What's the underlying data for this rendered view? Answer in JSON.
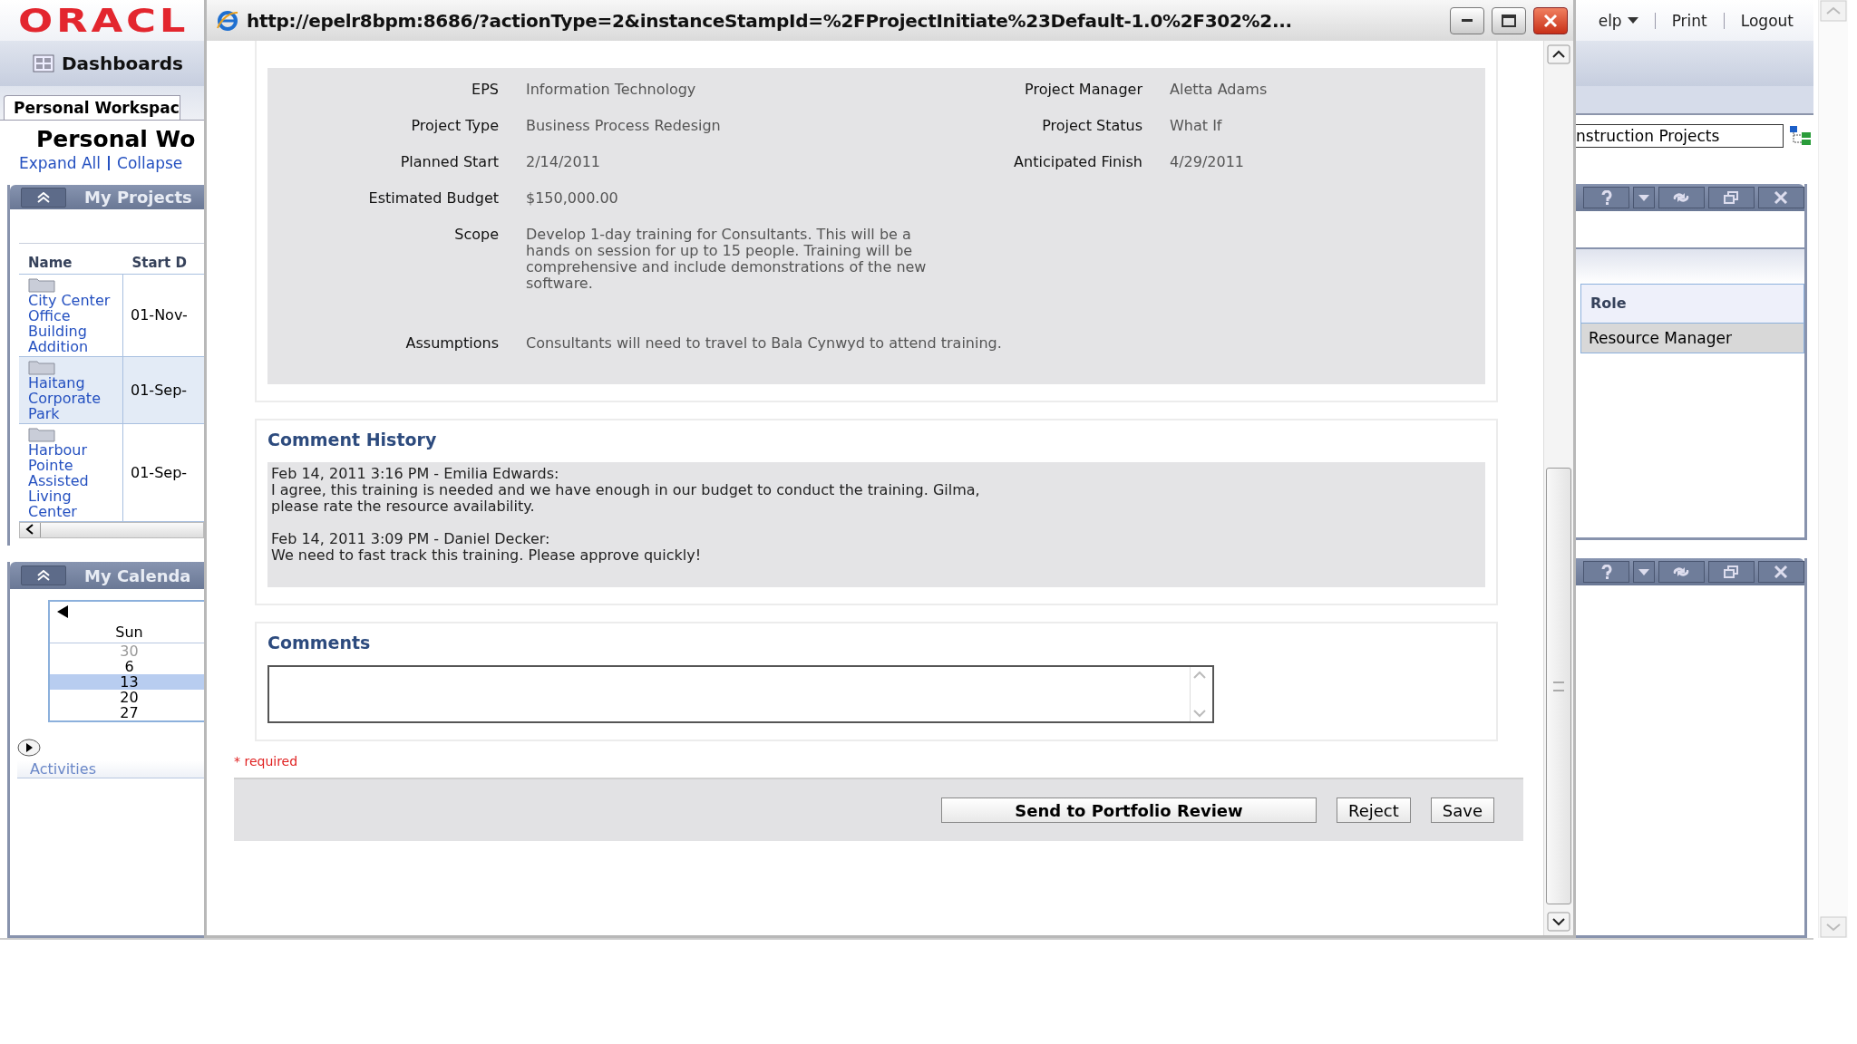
{
  "header": {
    "logo": "ORACL",
    "links": [
      {
        "label": "elp",
        "kind": "menu"
      },
      {
        "label": "Print",
        "kind": "link"
      },
      {
        "label": "Logout",
        "kind": "link"
      }
    ]
  },
  "nav": {
    "tab": "Dashboards"
  },
  "workspace": {
    "tab": "Personal Workspac",
    "title": "Personal Wo",
    "links": [
      "Expand All",
      "Collapse"
    ]
  },
  "my_projects": {
    "title": "My Projects",
    "columns": [
      "Name",
      "Start D"
    ],
    "rows": [
      {
        "name": "City Center Office Building Addition",
        "start": "01-Nov-",
        "selected": false
      },
      {
        "name": "Haitang Corporate Park",
        "start": "01-Sep-",
        "selected": true
      },
      {
        "name": "Harbour Pointe Assisted Living Center",
        "start": "01-Sep-",
        "selected": false
      }
    ]
  },
  "my_calendar": {
    "title": "My Calenda",
    "day_header": "Sun",
    "days": [
      {
        "label": "30",
        "muted": true,
        "selected": false
      },
      {
        "label": "6",
        "muted": false,
        "selected": false
      },
      {
        "label": "13",
        "muted": false,
        "selected": true
      },
      {
        "label": "20",
        "muted": false,
        "selected": false
      },
      {
        "label": "27",
        "muted": false,
        "selected": false
      }
    ]
  },
  "activities": {
    "label": "Activities"
  },
  "project_filter": {
    "value": "nstruction Projects"
  },
  "roles_portlet": {
    "columns": [
      "Role"
    ],
    "rows": [
      "Resource Manager"
    ]
  },
  "popup": {
    "title": "http://epelr8bpm:8686/?actionType=2&instanceStampId=%2FProjectInitiate%23Default-1.0%2F302%2...",
    "details": [
      [
        {
          "label": "EPS",
          "value": "Information Technology"
        },
        {
          "label": "Project Manager",
          "value": "Aletta Adams"
        }
      ],
      [
        {
          "label": "Project Type",
          "value": "Business Process Redesign"
        },
        {
          "label": "Project Status",
          "value": "What If"
        }
      ],
      [
        {
          "label": "Planned Start",
          "value": "2/14/2011"
        },
        {
          "label": "Anticipated Finish",
          "value": "4/29/2011"
        }
      ],
      [
        {
          "label": "Estimated Budget",
          "value": "$150,000.00"
        }
      ]
    ],
    "scope": {
      "label": "Scope",
      "lines": [
        "Develop 1-day training for Consultants.  This will be a",
        "hands on session for up to 15 people.  Training will be",
        "comprehensive and include demonstrations of the new",
        "software."
      ]
    },
    "assumptions": {
      "label": "Assumptions",
      "value": "Consultants will need to travel to Bala Cynwyd to attend training."
    },
    "comment_history": {
      "title": "Comment History",
      "entries": [
        {
          "header": "Feb 14, 2011 3:16 PM - Emilia Edwards:",
          "lines": [
            "I agree, this training is needed and we have enough in our budget to conduct the training.  Gilma,",
            "please rate the resource availability."
          ]
        },
        {
          "header": "Feb 14, 2011 3:09 PM - Daniel Decker:",
          "lines": [
            "We need to fast track this training.  Please approve quickly!"
          ]
        }
      ]
    },
    "comments": {
      "title": "Comments"
    },
    "required": {
      "mark": "*",
      "text": "required"
    },
    "buttons": [
      {
        "label": "Send to Portfolio Review",
        "kind": "primary"
      },
      {
        "label": "Reject",
        "kind": "normal"
      },
      {
        "label": "Save",
        "kind": "normal"
      }
    ]
  }
}
